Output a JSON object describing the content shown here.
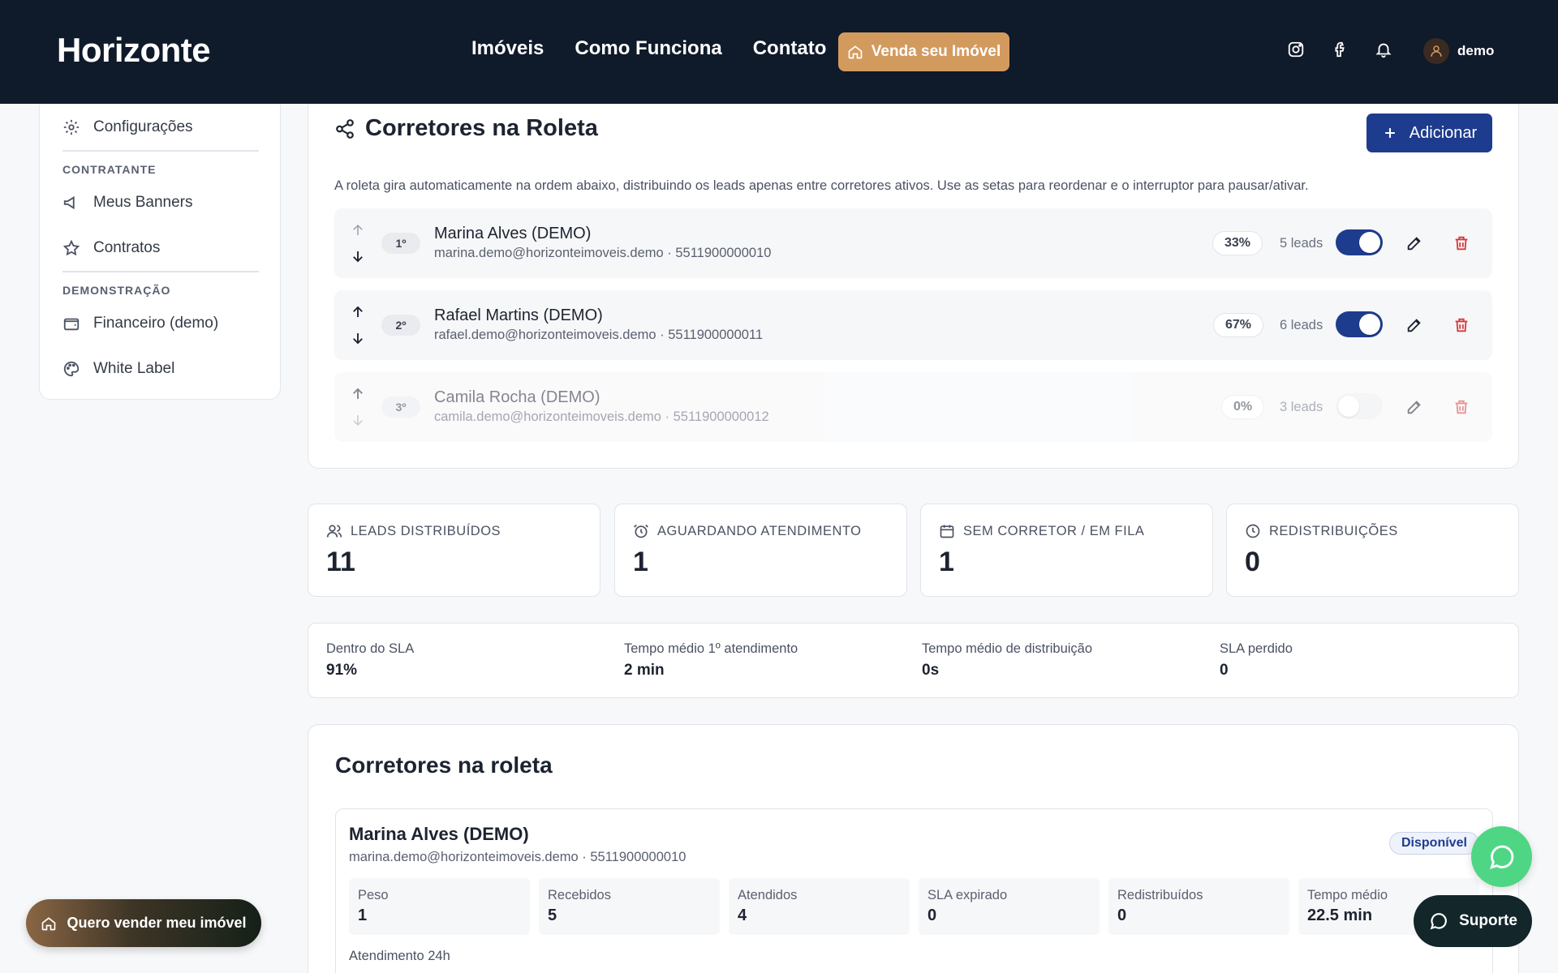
{
  "header": {
    "logo": "Horizonte",
    "nav": [
      "Imóveis",
      "Como Funciona",
      "Contato"
    ],
    "sell_button": "Venda seu Imóvel",
    "user_name": "demo",
    "icons": [
      "instagram-icon",
      "facebook-icon",
      "bell-icon",
      "user-icon"
    ]
  },
  "sidebar": {
    "settings": "Configurações",
    "section_contratante": "CONTRATANTE",
    "banners": "Meus Banners",
    "contratos": "Contratos",
    "section_demo": "DEMONSTRAÇÃO",
    "financeiro": "Financeiro (demo)",
    "white_label": "White Label"
  },
  "roleta": {
    "title": "Corretores na Roleta",
    "add_button": "Adicionar",
    "description": "A roleta gira automaticamente na ordem abaixo, distribuindo os leads apenas entre corretores ativos. Use as setas para reordenar e o interruptor para pausar/ativar.",
    "brokers": [
      {
        "pos": "1º",
        "name": "Marina Alves (DEMO)",
        "contact": "marina.demo@horizonteimoveis.demo · 5511900000010",
        "pct": "33%",
        "leads": "5 leads",
        "active": true
      },
      {
        "pos": "2º",
        "name": "Rafael Martins (DEMO)",
        "contact": "rafael.demo@horizonteimoveis.demo · 5511900000011",
        "pct": "67%",
        "leads": "6 leads",
        "active": true
      },
      {
        "pos": "3º",
        "name": "Camila Rocha (DEMO)",
        "contact": "camila.demo@horizonteimoveis.demo · 5511900000012",
        "pct": "0%",
        "leads": "3 leads",
        "active": false
      }
    ]
  },
  "stats": [
    {
      "label": "LEADS DISTRIBUÍDOS",
      "value": "11",
      "icon": "users-icon"
    },
    {
      "label": "AGUARDANDO ATENDIMENTO",
      "value": "1",
      "icon": "alarm-icon"
    },
    {
      "label": "SEM CORRETOR / EM FILA",
      "value": "1",
      "icon": "calendar-icon"
    },
    {
      "label": "REDISTRIBUIÇÕES",
      "value": "0",
      "icon": "clock-icon"
    }
  ],
  "sla": [
    {
      "label": "Dentro do SLA",
      "value": "91%"
    },
    {
      "label": "Tempo médio 1º atendimento",
      "value": "2 min"
    },
    {
      "label": "Tempo médio de distribuição",
      "value": "0s"
    },
    {
      "label": "SLA perdido",
      "value": "0"
    }
  ],
  "bottom": {
    "title": "Corretores na roleta",
    "broker_name": "Marina Alves (DEMO)",
    "broker_contact": "marina.demo@horizonteimoveis.demo · 5511900000010",
    "badge": "Disponível",
    "metrics": [
      {
        "label": "Peso",
        "value": "1"
      },
      {
        "label": "Recebidos",
        "value": "5"
      },
      {
        "label": "Atendidos",
        "value": "4"
      },
      {
        "label": "SLA expirado",
        "value": "0"
      },
      {
        "label": "Redistribuídos",
        "value": "0"
      },
      {
        "label": "Tempo médio",
        "value": "22.5 min"
      }
    ],
    "footer": "Atendimento 24h"
  },
  "floating": {
    "sell": "Quero vender meu imóvel",
    "support": "Suporte"
  },
  "colors": {
    "navy": "#0f1a2a",
    "accent": "#d39a5e",
    "primary": "#1e3c8e",
    "danger": "#d63a3a",
    "whatsapp": "#4fd685"
  }
}
